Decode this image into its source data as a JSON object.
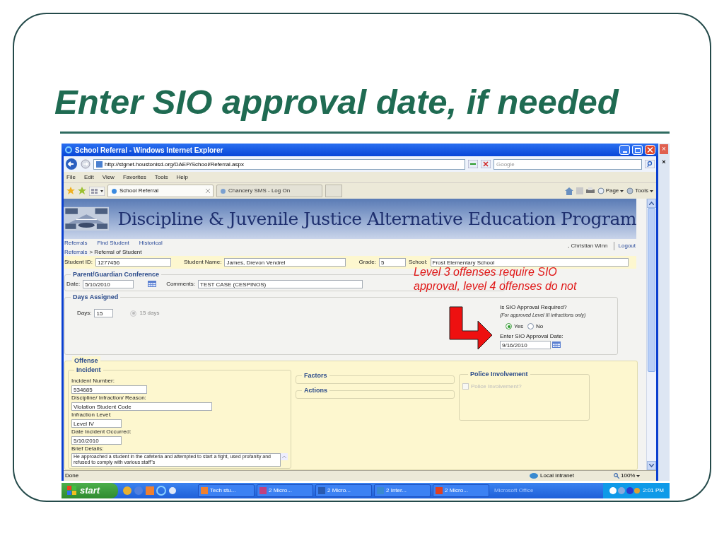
{
  "slide": {
    "title": "Enter SIO approval date, if needed"
  },
  "browser": {
    "window_title": "School Referral - Windows Internet Explorer",
    "address": "http://stgnet.houstonisd.org/DAEP/School/Referral.aspx",
    "search_placeholder": "Google",
    "menu": [
      "File",
      "Edit",
      "View",
      "Favorites",
      "Tools",
      "Help"
    ],
    "tabs": [
      {
        "label": "School Referral",
        "selected": true
      },
      {
        "label": "Chancery SMS - Log On",
        "selected": false
      }
    ],
    "commands": [
      "Page",
      "Tools"
    ]
  },
  "page": {
    "banner_title": "Discipline & Juvenile Justice Alternative Education Program",
    "nav": [
      "Referrals",
      "Find Student",
      "Historical"
    ],
    "user": ", Christian Winn",
    "logout": "Logout",
    "breadcrumb": {
      "link": "Referrals",
      "current": "> Referral of Student"
    },
    "student_fields": [
      {
        "label": "Student ID:",
        "value": "1277456"
      },
      {
        "label": "Student Name:",
        "value": "James, Drevon Vendrel"
      },
      {
        "label": "Grade:",
        "value": "5"
      },
      {
        "label": "School:",
        "value": "Frost Elementary School"
      }
    ],
    "conference": {
      "legend": "Parent/Guardian Conference",
      "date_label": "Date:",
      "date": "5/10/2010",
      "comments_label": "Comments:",
      "comments": "TEST CASE (CESPINOS)"
    },
    "days": {
      "legend": "Days Assigned",
      "days_label": "Days:",
      "days": "15",
      "option": {
        "label": "15 days",
        "selected": true,
        "disabled": true
      }
    },
    "sio": {
      "question": "Is SIO Approval Required?",
      "note": "(For approved Level III infractions only)",
      "options": [
        {
          "label": "Yes",
          "selected": true
        },
        {
          "label": "No",
          "selected": false
        }
      ],
      "date_label": "Enter SIO Approval Date:",
      "date": "9/16/2010"
    },
    "offense": {
      "legend": "Offense",
      "incident": {
        "legend": "Incident",
        "fields": [
          {
            "label": "Incident Number:",
            "value": "534685"
          },
          {
            "label": "Discipline/ Infraction/ Reason:",
            "value": "Violation Student Code"
          },
          {
            "label": "Infraction Level:",
            "value": "Level IV"
          },
          {
            "label": "Date Incident Occurred:",
            "value": "5/10/2010"
          }
        ],
        "details_label": "Brief Details:",
        "details": "He approached a student in the cafeteria and attempted to start a fight, used profanity and refused to comply with various staff\"s"
      },
      "factors_legend": "Factors",
      "actions_legend": "Actions",
      "police": {
        "legend": "Police Involvement",
        "label": "Police Involvement?",
        "checked": false,
        "disabled": true
      }
    }
  },
  "annotation": {
    "lines": [
      "Level 3 offenses require SIO",
      "approval, level 4 offenses do not"
    ]
  },
  "status_bar": {
    "text": "Done",
    "zone": "Local intranet",
    "zoom": "100%"
  },
  "taskbar": {
    "start": "start",
    "buttons": [
      {
        "label": "Tech stu..."
      },
      {
        "label": "2 Micro..."
      },
      {
        "label": "2 Micro..."
      },
      {
        "label": "2 Inter..."
      },
      {
        "label": "2 Micro..."
      }
    ],
    "toolbar": "Microsoft Office",
    "time": "2:01 PM"
  },
  "behind_window": {
    "closes": [
      "×",
      "×"
    ]
  }
}
